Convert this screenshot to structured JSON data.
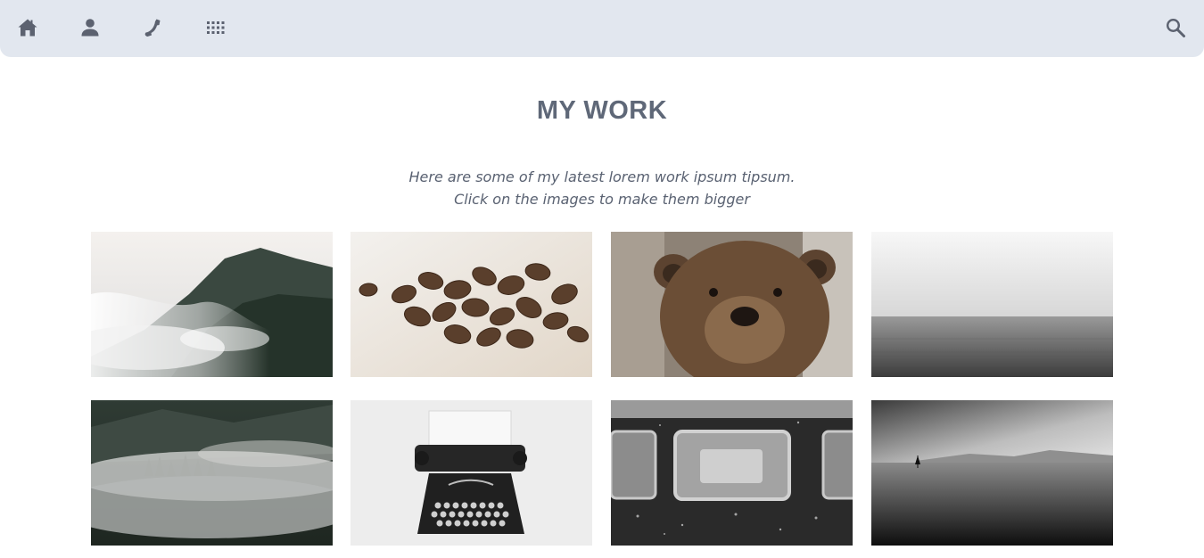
{
  "nav": {
    "items": [
      {
        "icon": "home-icon"
      },
      {
        "icon": "user-icon"
      },
      {
        "icon": "phone-icon"
      },
      {
        "icon": "grid-icon"
      }
    ],
    "search_icon": "search-icon"
  },
  "section": {
    "title": "MY WORK",
    "subtitle_line1": "Here are some of my latest lorem work ipsum tipsum.",
    "subtitle_line2": "Click on the images to make them bigger"
  },
  "gallery": {
    "images": [
      {
        "subject": "misty-mountain"
      },
      {
        "subject": "coffee-beans"
      },
      {
        "subject": "brown-bear"
      },
      {
        "subject": "foggy-sea"
      },
      {
        "subject": "fog-over-forest"
      },
      {
        "subject": "typewriter"
      },
      {
        "subject": "train-window"
      },
      {
        "subject": "sailboat-on-sea"
      }
    ]
  },
  "colors": {
    "topbar": "#e2e7ef",
    "icon": "#5c6270",
    "heading": "#5f6878"
  }
}
